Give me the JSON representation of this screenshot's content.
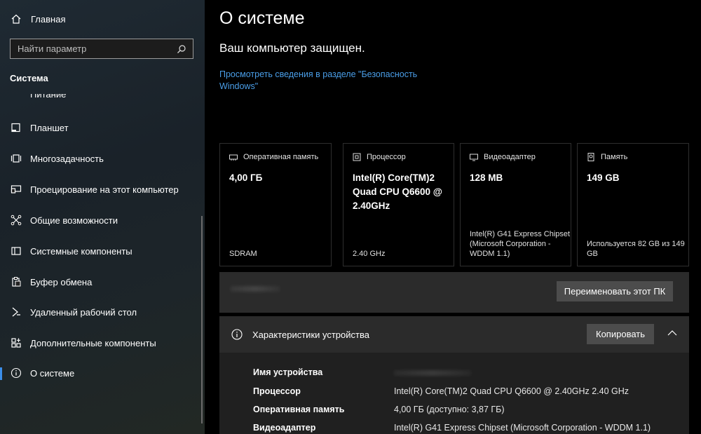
{
  "sidebar": {
    "home_label": "Главная",
    "search_placeholder": "Найти параметр",
    "section_title": "Система",
    "clipped_item": "Питание",
    "items": [
      {
        "label": "Планшет",
        "icon": "tablet-icon"
      },
      {
        "label": "Многозадачность",
        "icon": "multitasking-icon"
      },
      {
        "label": "Проецирование на этот компьютер",
        "icon": "projecting-icon"
      },
      {
        "label": "Общие возможности",
        "icon": "shared-experiences-icon"
      },
      {
        "label": "Системные компоненты",
        "icon": "system-components-icon"
      },
      {
        "label": "Буфер обмена",
        "icon": "clipboard-icon"
      },
      {
        "label": "Удаленный рабочий стол",
        "icon": "remote-desktop-icon"
      },
      {
        "label": "Дополнительные компоненты",
        "icon": "optional-features-icon"
      },
      {
        "label": "О системе",
        "icon": "info-icon",
        "active": true
      }
    ]
  },
  "main": {
    "title": "О системе",
    "protected_text": "Ваш компьютер защищен.",
    "security_link": "Просмотреть сведения в разделе \"Безопасность Windows\"",
    "cards": [
      {
        "label": "Оперативная память",
        "icon": "memory-icon",
        "value": "4,00 ГБ",
        "foot": "SDRAM"
      },
      {
        "label": "Процессор",
        "icon": "processor-icon",
        "value": "Intel(R) Core(TM)2 Quad CPU    Q6600 @ 2.40GHz",
        "foot": "2.40 GHz"
      },
      {
        "label": "Видеоадаптер",
        "icon": "display-adapter-icon",
        "value": "128 MB",
        "foot": "Intel(R) G41 Express Chipset (Microsoft Corporation - WDDM 1.1)"
      },
      {
        "label": "Память",
        "icon": "storage-icon",
        "value": "149 GB",
        "foot": "Используется 82 GB из 149 GB"
      }
    ],
    "rename_button": "Переименовать этот ПК",
    "specs": {
      "title": "Характеристики устройства",
      "copy_button": "Копировать",
      "rows": [
        {
          "key": "Имя устройства",
          "value": ""
        },
        {
          "key": "Процессор",
          "value": "Intel(R) Core(TM)2 Quad CPU    Q6600  @ 2.40GHz   2.40 GHz"
        },
        {
          "key": "Оперативная память",
          "value": "4,00 ГБ (доступно: 3,87 ГБ)"
        },
        {
          "key": "Видеоадаптер",
          "value": "Intel(R) G41 Express Chipset (Microsoft Corporation - WDDM 1.1)"
        }
      ]
    }
  },
  "colors": {
    "accent": "#3b8eea",
    "link": "#4a9ee8",
    "panel": "#2b2b2b",
    "button": "#4c4c4c"
  }
}
